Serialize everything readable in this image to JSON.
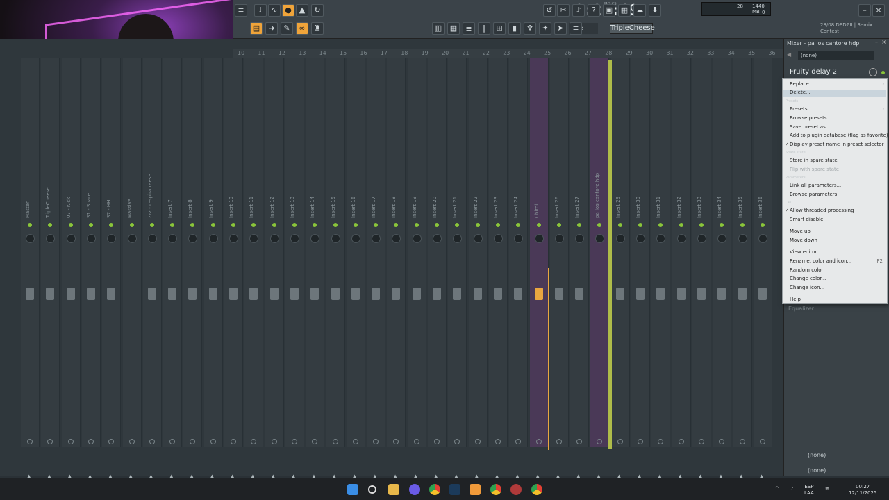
{
  "toolbar": {
    "time": "0:20:69",
    "tempo_label": "M:S:CS",
    "cpu_value": "28",
    "memory": "1440 MB",
    "voices": "0",
    "snap": "Line",
    "current_pattern": "TripleCheese",
    "hint_line1": "28/08  DEDZII | Remix",
    "hint_line2": "Contest"
  },
  "mixer": {
    "ruler": [
      "10",
      "11",
      "12",
      "13",
      "14",
      "15",
      "16",
      "17",
      "18",
      "19",
      "20",
      "21",
      "22",
      "23",
      "24",
      "25",
      "26",
      "27",
      "28",
      "29",
      "30",
      "31",
      "32",
      "33",
      "34",
      "35",
      "36"
    ],
    "channels": [
      "Master",
      "TripleCheese",
      "07 - Kick",
      "S1 - Snare",
      "S7 - HH",
      "Massive",
      "zzz - respira reese",
      "Insert 7",
      "Insert 8",
      "Insert 9",
      "Insert 10",
      "Insert 11",
      "Insert 12",
      "Insert 13",
      "Insert 14",
      "Insert 15",
      "Insert 16",
      "Insert 17",
      "Insert 18",
      "Insert 19",
      "Insert 20",
      "Insert 21",
      "Insert 22",
      "Insert 23",
      "Insert 24",
      "Chirol",
      "Insert 26",
      "Insert 27",
      "pa los cantore hdp",
      "Insert 29",
      "Insert 30",
      "Insert 31",
      "Insert 32",
      "Insert 33",
      "Insert 34",
      "Insert 35",
      "Insert 36"
    ]
  },
  "panel": {
    "title": "Mixer - pa los cantore hdp",
    "insert_combo": "(none)",
    "slot_name": "Fruity delay 2",
    "eq_label": "Equalizer",
    "bottom_in": "(none)",
    "bottom_out": "(none)"
  },
  "menu": {
    "replace": "Replace",
    "delete": "Delete...",
    "presets_section": "Presets",
    "presets": "Presets",
    "browse_presets": "Browse presets",
    "save_preset": "Save preset as...",
    "add_db": "Add to plugin database (flag as favorite)",
    "display_name": "Display preset name in preset selector",
    "spare_section": "Spare state",
    "store_spare": "Store in spare state",
    "flip_spare": "Flip with spare state",
    "params_section": "Parameters",
    "link_params": "Link all parameters...",
    "browse_params": "Browse parameters",
    "cpu_section": "CPU",
    "threaded": "Allow threaded processing",
    "smart_disable": "Smart disable",
    "move_up": "Move up",
    "move_down": "Move down",
    "view_editor": "View editor",
    "rename": "Rename, color and icon...",
    "rename_shortcut": "F2",
    "random_color": "Random color",
    "change_color": "Change color...",
    "change_icon": "Change icon...",
    "help": "Help"
  },
  "taskbar": {
    "lang1": "ESP",
    "lang2": "LAA",
    "clock": "00:27",
    "date": "12/11/2025"
  }
}
